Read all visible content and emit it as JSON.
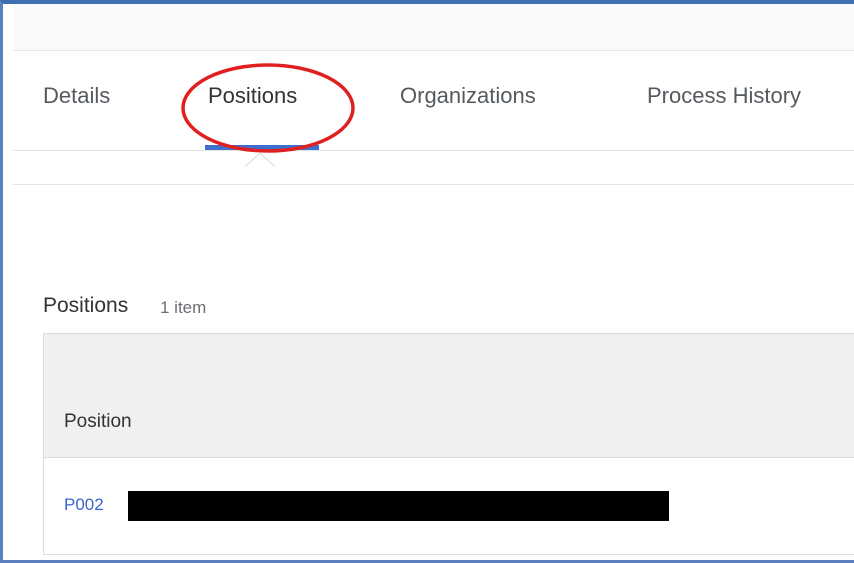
{
  "tabs": [
    {
      "label": "Details"
    },
    {
      "label": "Positions"
    },
    {
      "label": "Organizations"
    },
    {
      "label": "Process History"
    }
  ],
  "active_tab": "Positions",
  "section": {
    "title": "Positions",
    "count": "1 item"
  },
  "table": {
    "columns": [
      "Position"
    ],
    "rows": [
      {
        "position": "P002"
      }
    ]
  },
  "colors": {
    "accent": "#3f6fce",
    "link": "#3a66c9",
    "annotation": "#e02020",
    "redaction": "#000000"
  }
}
